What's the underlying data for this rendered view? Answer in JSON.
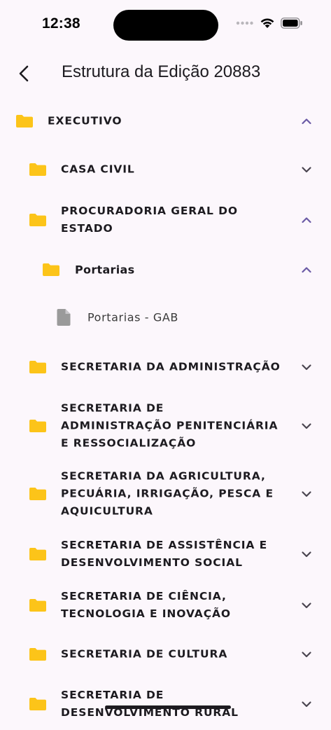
{
  "status_bar": {
    "time": "12:38"
  },
  "header": {
    "title": "Estrutura da Edição 20883"
  },
  "colors": {
    "folder": "#fcc419",
    "chevron_expanded": "#6a5aa5",
    "chevron_collapsed": "#4a4550",
    "file": "#9a9a9a",
    "background": "#fcf7fc"
  },
  "tree": {
    "items": [
      {
        "label": "EXECUTIVO",
        "expanded": true
      },
      {
        "label": "CASA CIVIL",
        "expanded": false
      },
      {
        "label": "PROCURADORIA GERAL DO ESTADO",
        "expanded": true
      },
      {
        "label": "Portarias",
        "expanded": true
      },
      {
        "label": "Portarias - GAB"
      },
      {
        "label": "SECRETARIA DA ADMINISTRAÇÃO",
        "expanded": false
      },
      {
        "label": "SECRETARIA DE ADMINISTRAÇÃO PENITENCIÁRIA E RESSOCIALIZAÇÃO",
        "expanded": false
      },
      {
        "label": "SECRETARIA DA AGRICULTURA, PECUÁRIA, IRRIGAÇÃO, PESCA E AQUICULTURA",
        "expanded": false
      },
      {
        "label": "SECRETARIA DE ASSISTÊNCIA E DESENVOLVIMENTO SOCIAL",
        "expanded": false
      },
      {
        "label": "SECRETARIA DE CIÊNCIA, TECNOLOGIA E INOVAÇÃO",
        "expanded": false
      },
      {
        "label": "SECRETARIA DE CULTURA",
        "expanded": false
      },
      {
        "label": "SECRETARIA DE DESENVOLVIMENTO RURAL",
        "expanded": false
      }
    ]
  }
}
